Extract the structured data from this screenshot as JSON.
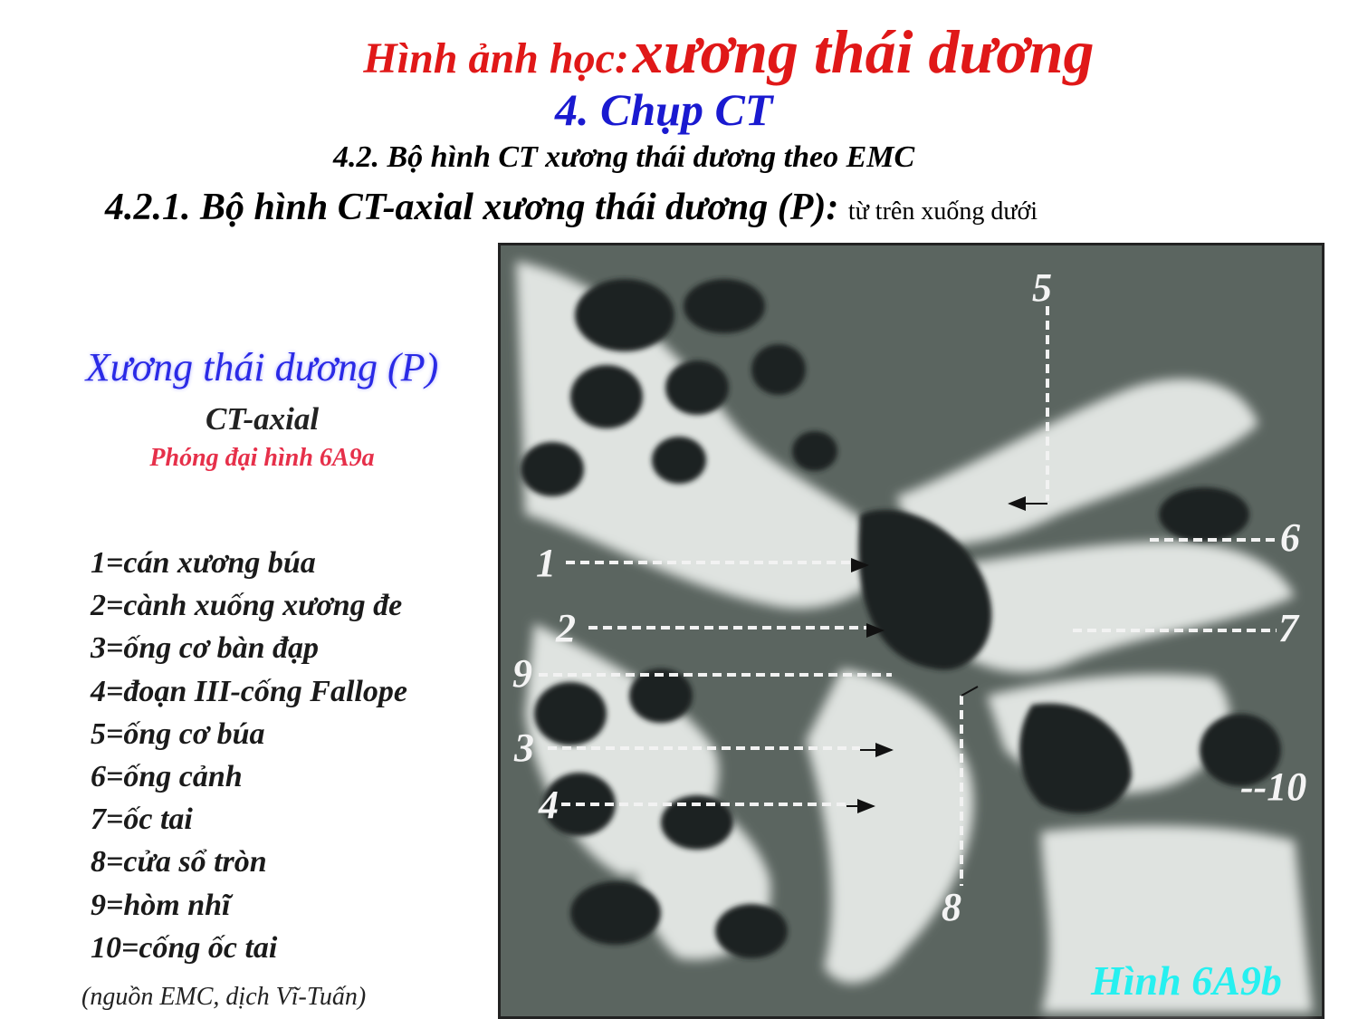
{
  "header": {
    "title_prefix": "Hình ảnh học:",
    "title_main": "xương thái dương",
    "subtitle": "4. Chụp CT",
    "section": "4.2. Bộ hình CT xương thái dương theo EMC",
    "subsection": "4.2.1. Bộ hình CT-axial xương thái dương (P):",
    "subsection_note": "từ trên xuống dưới"
  },
  "panel": {
    "title": "Xương thái dương (P)",
    "subtitle": "CT-axial",
    "magnify_note": "Phóng đại hình 6A9a",
    "legend": [
      "1=cán xương búa",
      "2=cành xuống xương đe",
      "3=ống cơ bàn đạp",
      "4=đoạn III-cống Fallope",
      "5=ống cơ búa",
      "6=ống cảnh",
      "7=ốc tai",
      "8=cửa sổ tròn",
      "9=hòm nhĩ",
      "10=cống ốc tai"
    ],
    "source": "(nguồn EMC, dịch Vĩ-Tuấn)"
  },
  "figure": {
    "labels": [
      "1",
      "2",
      "3",
      "4",
      "5",
      "6",
      "7",
      "8",
      "9",
      "--10"
    ],
    "caption": "Hình 6A9b"
  }
}
